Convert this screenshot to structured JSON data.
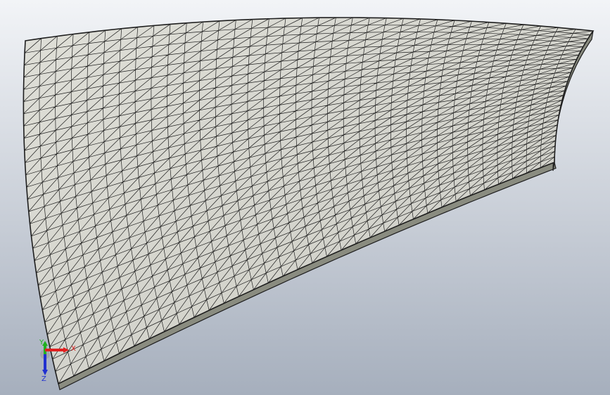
{
  "viewport": {
    "name": "graphics-area",
    "background_top": "#f2f4f7",
    "background_bottom": "#a6afbd"
  },
  "model": {
    "face_color": "#dcdcd4",
    "edge_color": "#1e1e1e",
    "side_color": "#8a8c80",
    "mesh_columns": 34,
    "mesh_rows": 28
  },
  "triad": {
    "x_label": "X",
    "y_label": "Y",
    "z_label": "Z",
    "x_color": "#e02020",
    "y_color": "#20b020",
    "z_color": "#2030d0"
  }
}
